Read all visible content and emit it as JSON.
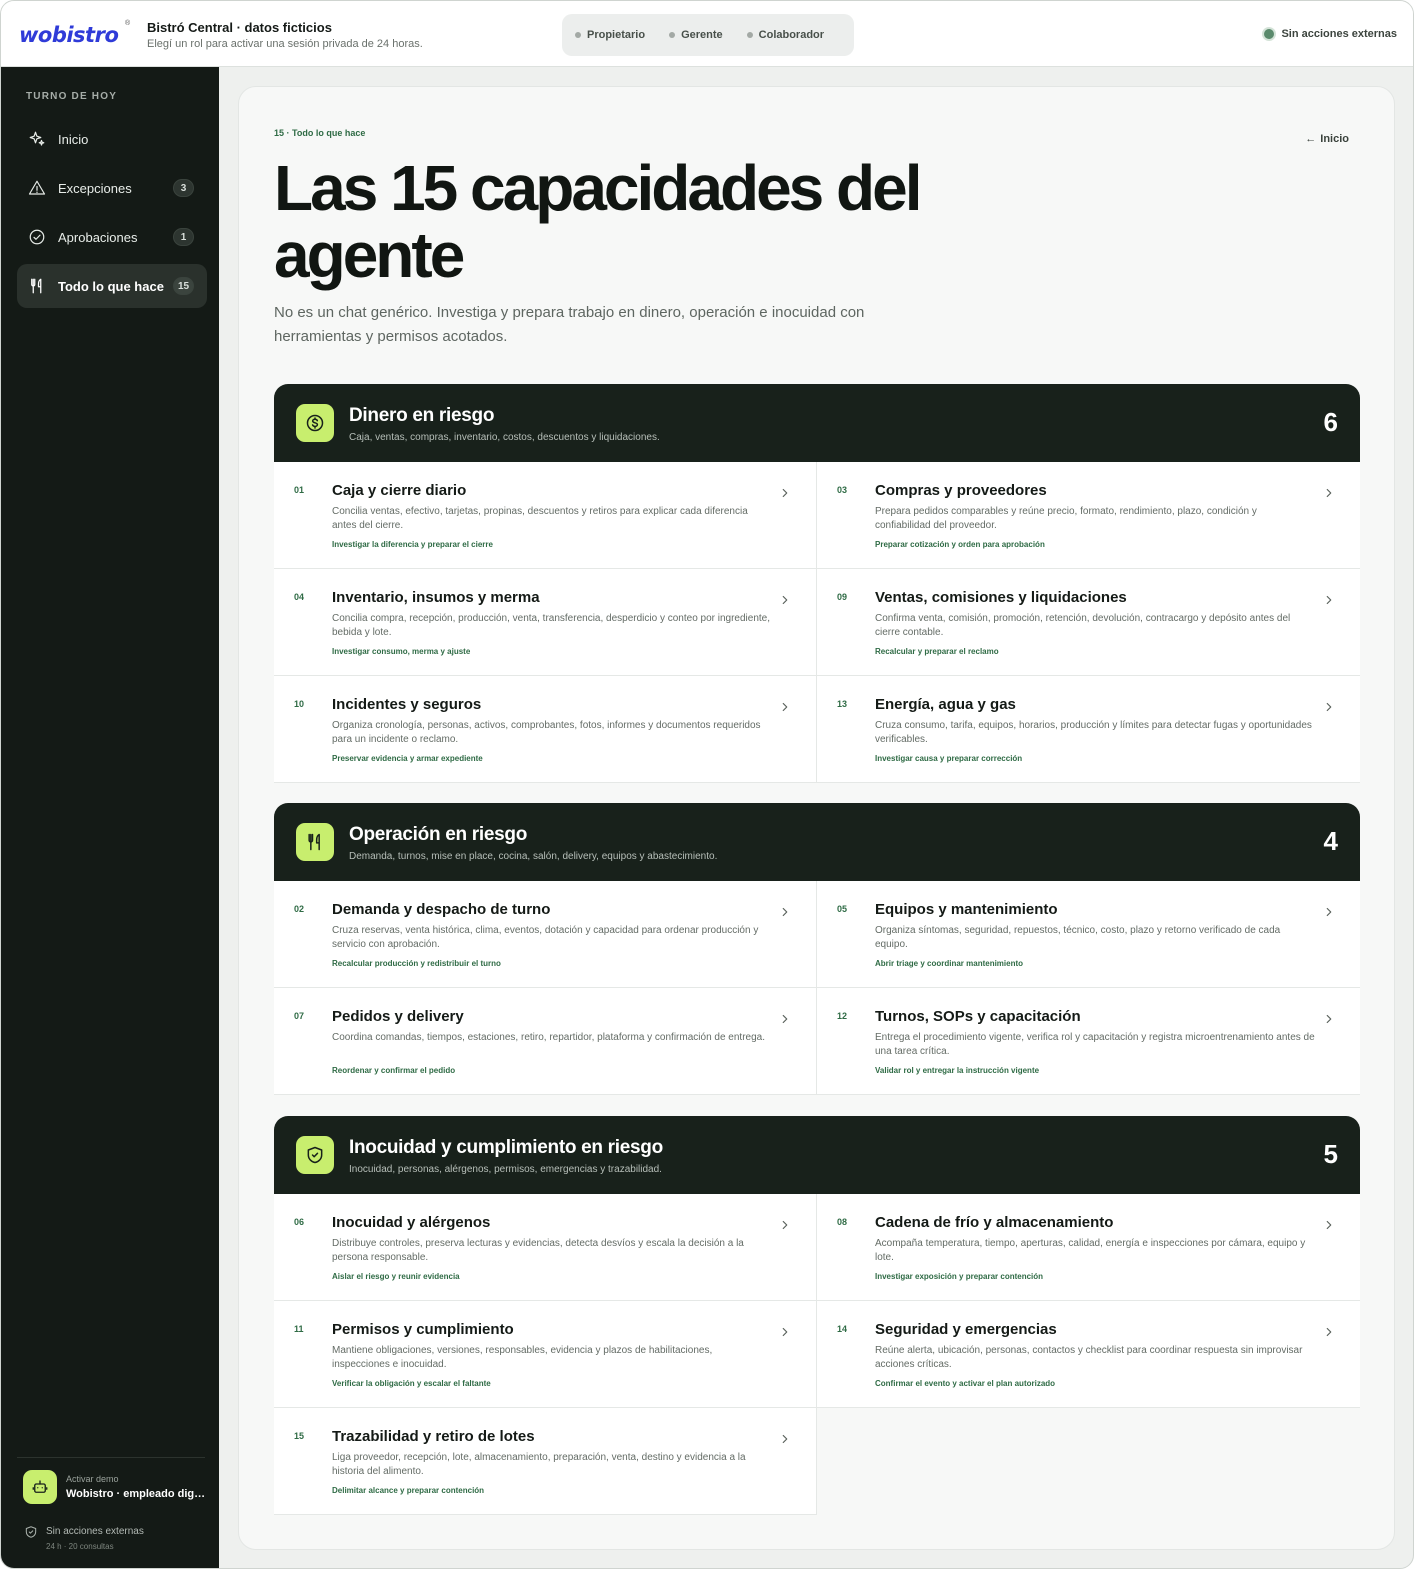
{
  "header": {
    "logo": "wobistro",
    "logo_mark": "®",
    "business_title": "Bistró Central · datos ficticios",
    "business_subtitle": "Elegí un rol para activar una sesión privada de 24 horas.",
    "roles": [
      "Propietario",
      "Gerente",
      "Colaborador"
    ],
    "external_status": "Sin acciones externas"
  },
  "sidebar": {
    "heading": "TURNO DE HOY",
    "items": [
      {
        "label": "Inicio",
        "icon": "sparkle-icon",
        "badge": ""
      },
      {
        "label": "Excepciones",
        "icon": "warning-icon",
        "badge": "3"
      },
      {
        "label": "Aprobaciones",
        "icon": "check-circle-icon",
        "badge": "1"
      },
      {
        "label": "Todo lo que hace",
        "icon": "utensils-icon",
        "badge": "15"
      }
    ],
    "demo_label": "Activar demo",
    "demo_name": "Wobistro · empleado digital",
    "external_label": "Sin acciones externas",
    "usage": "24 h · 20 consultas"
  },
  "main": {
    "eyebrow": "15 · Todo lo que hace",
    "back_label": "Inicio",
    "title": "Las 15 capacidades del agente",
    "description": "No es un chat genérico. Investiga y prepara trabajo en dinero, operación e inocuidad con herramientas y permisos acotados."
  },
  "groups": [
    {
      "title": "Dinero en riesgo",
      "subtitle": "Caja, ventas, compras, inventario, costos, descuentos y liquidaciones.",
      "count": "6",
      "icon": "dollar-icon",
      "items": [
        {
          "num": "01",
          "title": "Caja y cierre diario",
          "desc": "Concilia ventas, efectivo, tarjetas, propinas, descuentos y retiros para explicar cada diferencia antes del cierre.",
          "action": "Investigar la diferencia y preparar el cierre"
        },
        {
          "num": "03",
          "title": "Compras y proveedores",
          "desc": "Prepara pedidos comparables y reúne precio, formato, rendimiento, plazo, condición y confiabilidad del proveedor.",
          "action": "Preparar cotización y orden para aprobación"
        },
        {
          "num": "04",
          "title": "Inventario, insumos y merma",
          "desc": "Concilia compra, recepción, producción, venta, transferencia, desperdicio y conteo por ingrediente, bebida y lote.",
          "action": "Investigar consumo, merma y ajuste"
        },
        {
          "num": "09",
          "title": "Ventas, comisiones y liquidaciones",
          "desc": "Confirma venta, comisión, promoción, retención, devolución, contracargo y depósito antes del cierre contable.",
          "action": "Recalcular y preparar el reclamo"
        },
        {
          "num": "10",
          "title": "Incidentes y seguros",
          "desc": "Organiza cronología, personas, activos, comprobantes, fotos, informes y documentos requeridos para un incidente o reclamo.",
          "action": "Preservar evidencia y armar expediente"
        },
        {
          "num": "13",
          "title": "Energía, agua y gas",
          "desc": "Cruza consumo, tarifa, equipos, horarios, producción y límites para detectar fugas y oportunidades verificables.",
          "action": "Investigar causa y preparar corrección"
        }
      ]
    },
    {
      "title": "Operación en riesgo",
      "subtitle": "Demanda, turnos, mise en place, cocina, salón, delivery, equipos y abastecimiento.",
      "count": "4",
      "icon": "utensils-icon",
      "items": [
        {
          "num": "02",
          "title": "Demanda y despacho de turno",
          "desc": "Cruza reservas, venta histórica, clima, eventos, dotación y capacidad para ordenar producción y servicio con aprobación.",
          "action": "Recalcular producción y redistribuir el turno"
        },
        {
          "num": "05",
          "title": "Equipos y mantenimiento",
          "desc": "Organiza síntomas, seguridad, repuestos, técnico, costo, plazo y retorno verificado de cada equipo.",
          "action": "Abrir triage y coordinar mantenimiento"
        },
        {
          "num": "07",
          "title": "Pedidos y delivery",
          "desc": "Coordina comandas, tiempos, estaciones, retiro, repartidor, plataforma y confirmación de entrega.",
          "action": "Reordenar y confirmar el pedido"
        },
        {
          "num": "12",
          "title": "Turnos, SOPs y capacitación",
          "desc": "Entrega el procedimiento vigente, verifica rol y capacitación y registra microentrenamiento antes de una tarea crítica.",
          "action": "Validar rol y entregar la instrucción vigente"
        }
      ]
    },
    {
      "title": "Inocuidad y cumplimiento en riesgo",
      "subtitle": "Inocuidad, personas, alérgenos, permisos, emergencias y trazabilidad.",
      "count": "5",
      "icon": "shield-icon",
      "items": [
        {
          "num": "06",
          "title": "Inocuidad y alérgenos",
          "desc": "Distribuye controles, preserva lecturas y evidencias, detecta desvíos y escala la decisión a la persona responsable.",
          "action": "Aislar el riesgo y reunir evidencia"
        },
        {
          "num": "08",
          "title": "Cadena de frío y almacenamiento",
          "desc": "Acompaña temperatura, tiempo, aperturas, calidad, energía e inspecciones por cámara, equipo y lote.",
          "action": "Investigar exposición y preparar contención"
        },
        {
          "num": "11",
          "title": "Permisos y cumplimiento",
          "desc": "Mantiene obligaciones, versiones, responsables, evidencia y plazos de habilitaciones, inspecciones e inocuidad.",
          "action": "Verificar la obligación y escalar el faltante"
        },
        {
          "num": "14",
          "title": "Seguridad y emergencias",
          "desc": "Reúne alerta, ubicación, personas, contactos y checklist para coordinar respuesta sin improvisar acciones críticas.",
          "action": "Confirmar el evento y activar el plan autorizado"
        },
        {
          "num": "15",
          "title": "Trazabilidad y retiro de lotes",
          "desc": "Liga proveedor, recepción, lote, almacenamiento, preparación, venta, destino y evidencia a la historia del alimento.",
          "action": "Delimitar alcance y preparar contención"
        }
      ]
    }
  ],
  "colors": {
    "accent_lime": "#c8ee6e",
    "dark_panel": "#18211b",
    "brand_blue": "#2f3bd8",
    "green_text": "#2f6b45"
  }
}
